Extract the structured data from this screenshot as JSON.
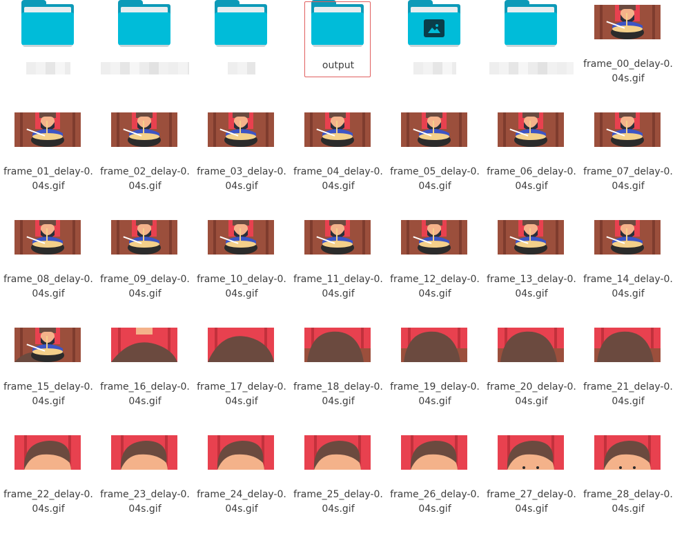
{
  "window": {
    "title": ""
  },
  "folders": [
    {
      "name": "",
      "type": "folder",
      "selected": false
    },
    {
      "name": "",
      "type": "folder",
      "selected": false
    },
    {
      "name": "",
      "type": "folder",
      "selected": false
    },
    {
      "name": "output",
      "type": "folder",
      "selected": true
    },
    {
      "name": "",
      "type": "image-folder",
      "selected": false
    },
    {
      "name": "",
      "type": "folder",
      "selected": false
    }
  ],
  "files": [
    {
      "name": "frame_00_delay-0.04s.gif",
      "scene": "eat"
    },
    {
      "name": "frame_01_delay-0.04s.gif",
      "scene": "eat"
    },
    {
      "name": "frame_02_delay-0.04s.gif",
      "scene": "eat"
    },
    {
      "name": "frame_03_delay-0.04s.gif",
      "scene": "eat"
    },
    {
      "name": "frame_04_delay-0.04s.gif",
      "scene": "eat"
    },
    {
      "name": "frame_05_delay-0.04s.gif",
      "scene": "eat"
    },
    {
      "name": "frame_06_delay-0.04s.gif",
      "scene": "eat"
    },
    {
      "name": "frame_07_delay-0.04s.gif",
      "scene": "eat"
    },
    {
      "name": "frame_08_delay-0.04s.gif",
      "scene": "eat2"
    },
    {
      "name": "frame_09_delay-0.04s.gif",
      "scene": "eat2"
    },
    {
      "name": "frame_10_delay-0.04s.gif",
      "scene": "eat2"
    },
    {
      "name": "frame_11_delay-0.04s.gif",
      "scene": "eat2"
    },
    {
      "name": "frame_12_delay-0.04s.gif",
      "scene": "eat2"
    },
    {
      "name": "frame_13_delay-0.04s.gif",
      "scene": "eat2"
    },
    {
      "name": "frame_14_delay-0.04s.gif",
      "scene": "eat2"
    },
    {
      "name": "frame_15_delay-0.04s.gif",
      "scene": "eat3"
    },
    {
      "name": "frame_16_delay-0.04s.gif",
      "scene": "hair1"
    },
    {
      "name": "frame_17_delay-0.04s.gif",
      "scene": "hair2"
    },
    {
      "name": "frame_18_delay-0.04s.gif",
      "scene": "hair3"
    },
    {
      "name": "frame_19_delay-0.04s.gif",
      "scene": "hair3"
    },
    {
      "name": "frame_20_delay-0.04s.gif",
      "scene": "hair3"
    },
    {
      "name": "frame_21_delay-0.04s.gif",
      "scene": "hair3"
    },
    {
      "name": "frame_22_delay-0.04s.gif",
      "scene": "head1"
    },
    {
      "name": "frame_23_delay-0.04s.gif",
      "scene": "head1"
    },
    {
      "name": "frame_24_delay-0.04s.gif",
      "scene": "head2"
    },
    {
      "name": "frame_25_delay-0.04s.gif",
      "scene": "head2"
    },
    {
      "name": "frame_26_delay-0.04s.gif",
      "scene": "head3"
    },
    {
      "name": "frame_27_delay-0.04s.gif",
      "scene": "head4"
    },
    {
      "name": "frame_28_delay-0.04s.gif",
      "scene": "head5"
    }
  ],
  "colors": {
    "folder_front": "#00bcd9",
    "folder_back": "#0d9ab8",
    "selection_border": "#e05d5d",
    "bg_red": "#e8414f",
    "bg_brown": "#9b4f3c",
    "hair": "#6b4a3f",
    "skin": "#f4b28a",
    "shirt": "#3d55c5"
  }
}
